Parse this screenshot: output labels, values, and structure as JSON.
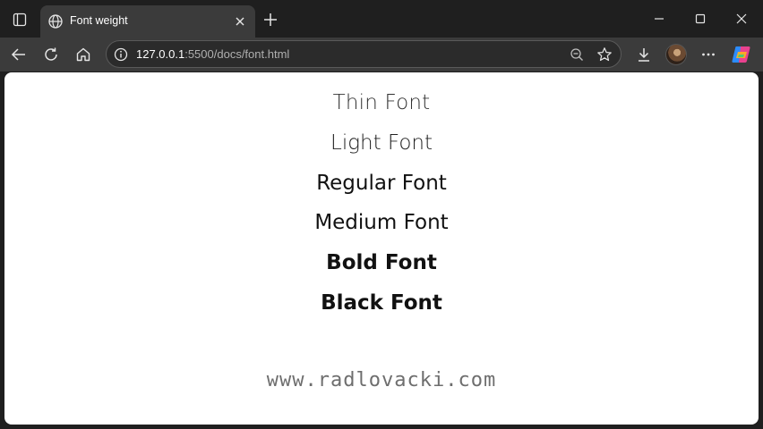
{
  "window": {
    "tab_title": "Font weight",
    "minimize_icon": "minimize-icon",
    "maximize_icon": "maximize-icon",
    "close_icon": "close-icon"
  },
  "toolbar": {
    "url_host": "127.0.0.1",
    "url_path": ":5500/docs/font.html",
    "icons": [
      "back-icon",
      "reload-icon",
      "home-icon",
      "info-icon",
      "zoom-out-icon",
      "star-icon",
      "download-icon",
      "avatar",
      "more-icon",
      "copilot-icon"
    ]
  },
  "page": {
    "lines": [
      "Thin Font",
      "Light Font",
      "Regular Font",
      "Medium Font",
      "Bold Font",
      "Black Font"
    ],
    "watermark": "www.radlovacki.com"
  },
  "colors": {
    "chrome_dark": "#1f1f1f",
    "chrome_toolbar": "#3b3b3b",
    "page_bg": "#ffffff",
    "watermark": "#6e6e6e"
  }
}
